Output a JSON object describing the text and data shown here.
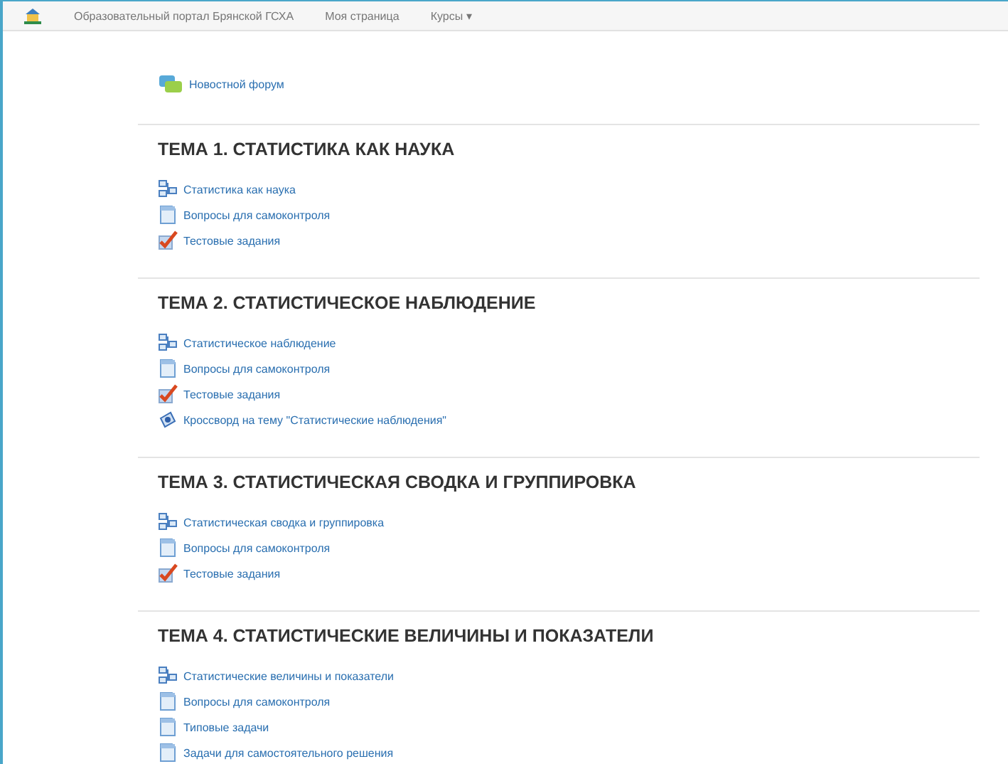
{
  "navbar": {
    "brand": "Образовательный портал Брянской ГСХА",
    "links": [
      {
        "label": "Моя страница"
      },
      {
        "label": "Курсы",
        "caret": "▾"
      }
    ]
  },
  "forum": {
    "kind": "forum",
    "label": "Новостной форум"
  },
  "sections": [
    {
      "title": "ТЕМА 1. СТАТИСТИКА КАК НАУКА",
      "items": [
        {
          "kind": "book",
          "label": "Статистика как наука"
        },
        {
          "kind": "page",
          "label": "Вопросы для самоконтроля"
        },
        {
          "kind": "quiz",
          "label": "Тестовые задания"
        }
      ]
    },
    {
      "title": "ТЕМА 2. СТАТИСТИЧЕСКОЕ НАБЛЮДЕНИЕ",
      "items": [
        {
          "kind": "book",
          "label": "Статистическое наблюдение"
        },
        {
          "kind": "page",
          "label": "Вопросы для самоконтроля"
        },
        {
          "kind": "quiz",
          "label": "Тестовые задания"
        },
        {
          "kind": "crossword",
          "label": "Кроссворд на тему \"Статистические наблюдения\""
        }
      ]
    },
    {
      "title": "ТЕМА 3. СТАТИСТИЧЕСКАЯ СВОДКА И ГРУППИРОВКА",
      "items": [
        {
          "kind": "book",
          "label": "Статистическая сводка и группировка"
        },
        {
          "kind": "page",
          "label": "Вопросы для самоконтроля"
        },
        {
          "kind": "quiz",
          "label": "Тестовые задания"
        }
      ]
    },
    {
      "title": "ТЕМА 4. СТАТИСТИЧЕСКИЕ ВЕЛИЧИНЫ И ПОКАЗАТЕЛИ",
      "items": [
        {
          "kind": "book",
          "label": "Статистические величины и показатели"
        },
        {
          "kind": "page",
          "label": "Вопросы для самоконтроля"
        },
        {
          "kind": "page",
          "label": "Типовые задачи"
        },
        {
          "kind": "page",
          "label": "Задачи для самостоятельного решения"
        }
      ]
    }
  ]
}
